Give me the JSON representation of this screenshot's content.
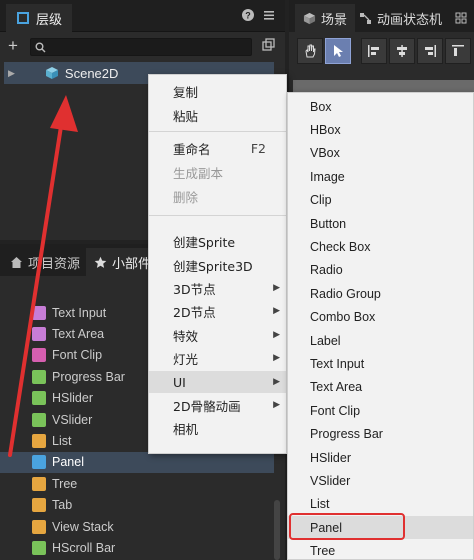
{
  "hierarchy": {
    "tab_label": "层级",
    "help_icon": "help-icon",
    "menu_icon": "menu-icon",
    "scene_node": "Scene2D"
  },
  "scene": {
    "tabs": [
      {
        "label": "场景"
      },
      {
        "label": "动画状态机"
      }
    ]
  },
  "bottom": {
    "tabs": [
      {
        "label": "项目资源"
      },
      {
        "label": "小部件"
      }
    ],
    "widgets": [
      {
        "label": "Text Input",
        "color": "#c77dd6"
      },
      {
        "label": "Text Area",
        "color": "#c77dd6"
      },
      {
        "label": "Font Clip",
        "color": "#d65fb0"
      },
      {
        "label": "Progress Bar",
        "color": "#7ac35a"
      },
      {
        "label": "HSlider",
        "color": "#7ac35a"
      },
      {
        "label": "VSlider",
        "color": "#7ac35a"
      },
      {
        "label": "List",
        "color": "#e6a640"
      },
      {
        "label": "Panel",
        "color": "#4aa3df"
      },
      {
        "label": "Tree",
        "color": "#e6a640"
      },
      {
        "label": "Tab",
        "color": "#e6a640"
      },
      {
        "label": "View Stack",
        "color": "#e6a640"
      },
      {
        "label": "HScroll Bar",
        "color": "#7ac35a"
      }
    ],
    "selected_widget": "Panel"
  },
  "context_menu": {
    "copy": "复制",
    "paste": "粘贴",
    "rename": "重命名",
    "rename_shortcut": "F2",
    "duplicate": "生成副本",
    "delete": "删除",
    "create_sprite": "创建Sprite",
    "create_sprite3d": "创建Sprite3D",
    "node3d": "3D节点",
    "node2d": "2D节点",
    "effects": "特效",
    "light": "灯光",
    "ui": "UI",
    "skeleton2d": "2D骨骼动画",
    "camera": "相机"
  },
  "ui_submenu": {
    "items": [
      "Box",
      "HBox",
      "VBox",
      "Image",
      "Clip",
      "Button",
      "Check Box",
      "Radio",
      "Radio Group",
      "Combo Box",
      "Label",
      "Text Input",
      "Text Area",
      "Font Clip",
      "Progress Bar",
      "HSlider",
      "VSlider",
      "List",
      "Panel",
      "Tree"
    ],
    "highlighted": "Panel"
  },
  "colors": {
    "accent_selection": "#3d4a5a",
    "annotation_red": "#e03030"
  }
}
